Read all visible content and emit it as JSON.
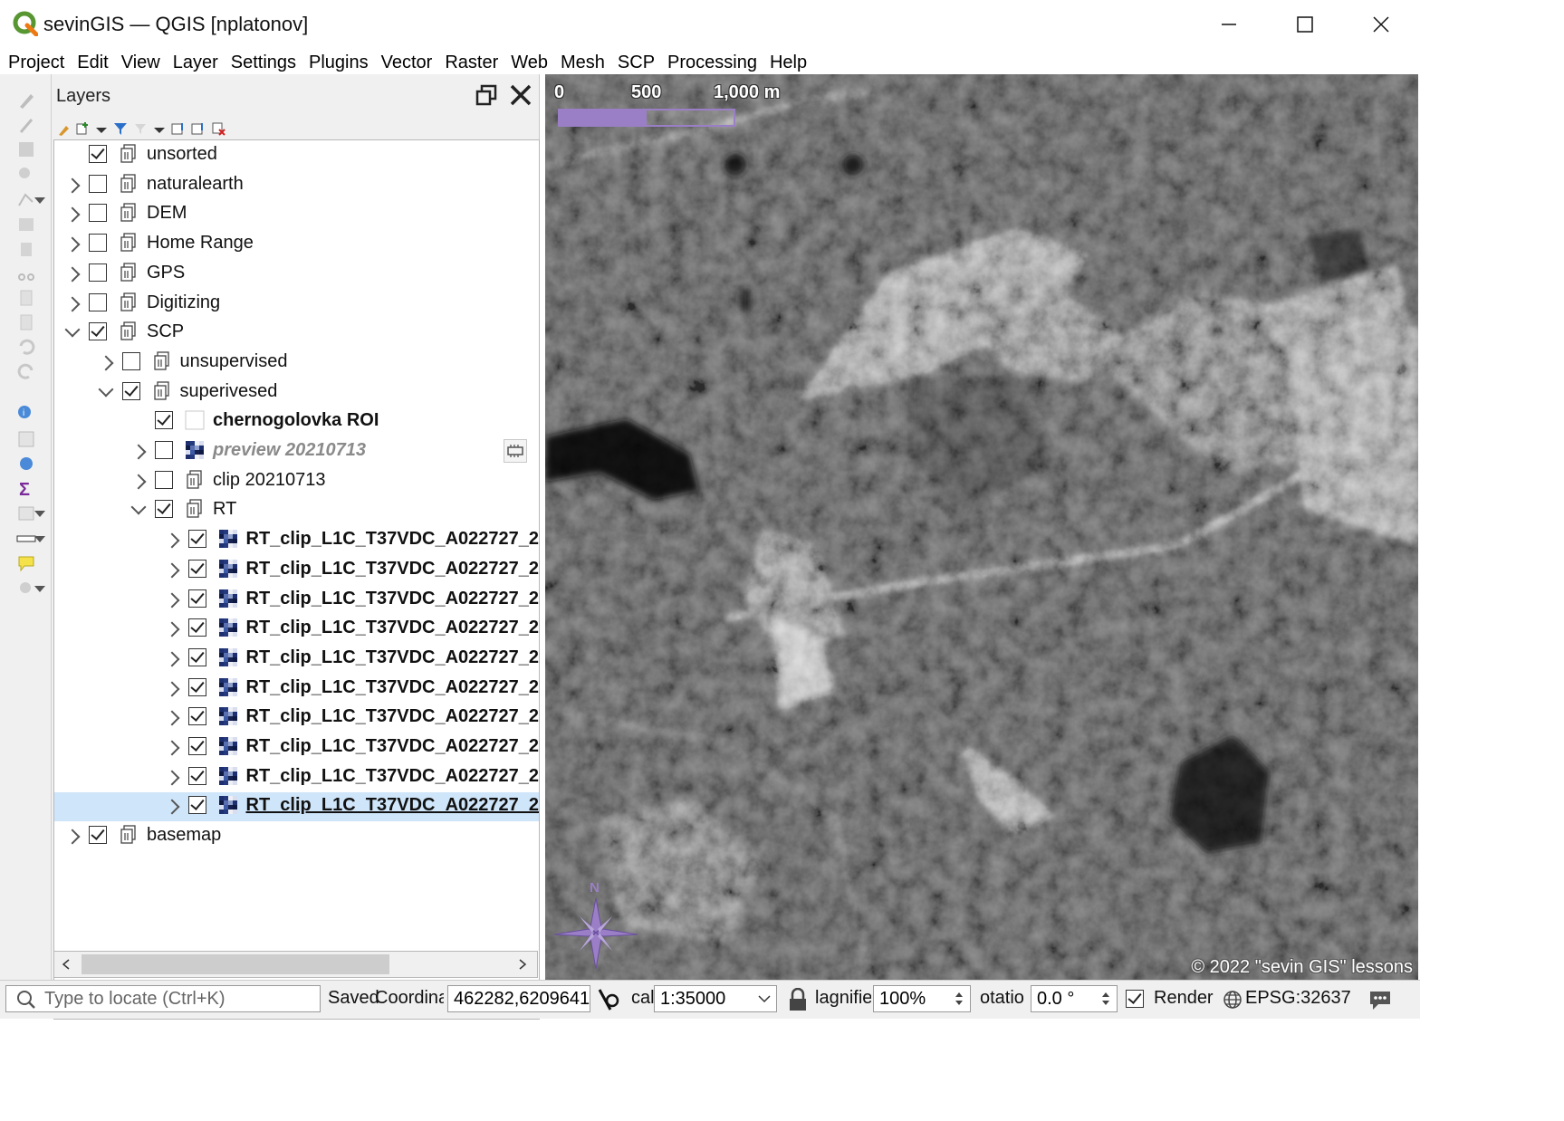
{
  "window": {
    "title": "sevinGIS — QGIS [nplatonov]",
    "controls": [
      "minimize",
      "maximize",
      "close"
    ]
  },
  "menu": [
    "Project",
    "Edit",
    "View",
    "Layer",
    "Settings",
    "Plugins",
    "Vector",
    "Raster",
    "Web",
    "Mesh",
    "SCP",
    "Processing",
    "Help"
  ],
  "layers_panel": {
    "title": "Layers",
    "tree": [
      {
        "label": "unsorted",
        "checked": true,
        "expander": "none",
        "icon": "group-icon",
        "level": 0
      },
      {
        "label": "naturalearth",
        "checked": false,
        "expander": "closed",
        "icon": "group-icon",
        "level": 0
      },
      {
        "label": "DEM",
        "checked": false,
        "expander": "closed",
        "icon": "group-icon",
        "level": 0
      },
      {
        "label": "Home Range",
        "checked": false,
        "expander": "closed",
        "icon": "group-icon",
        "level": 0
      },
      {
        "label": "GPS",
        "checked": false,
        "expander": "closed",
        "icon": "group-icon",
        "level": 0
      },
      {
        "label": "Digitizing",
        "checked": false,
        "expander": "closed",
        "icon": "group-icon",
        "level": 0
      },
      {
        "label": "SCP",
        "checked": true,
        "expander": "open",
        "icon": "group-icon",
        "level": 0
      },
      {
        "label": "unsupervised",
        "checked": false,
        "expander": "closed",
        "icon": "group-icon",
        "level": 1
      },
      {
        "label": "superivesed",
        "checked": true,
        "expander": "open",
        "icon": "group-icon",
        "level": 1
      },
      {
        "label": "chernogolovka ROI",
        "checked": true,
        "expander": "none",
        "icon": "polygon-layer-icon",
        "level": 2,
        "style": "bold"
      },
      {
        "label": "preview 20210713",
        "checked": false,
        "expander": "closed",
        "icon": "raster-layer-icon",
        "level": 2,
        "style": "italic",
        "indicator": "memory-indicator-icon"
      },
      {
        "label": "clip 20210713",
        "checked": false,
        "expander": "closed",
        "icon": "group-icon",
        "level": 2
      },
      {
        "label": "RT",
        "checked": true,
        "expander": "open",
        "icon": "group-icon",
        "level": 2
      },
      {
        "label": "RT_clip_L1C_T37VDC_A022727_2",
        "checked": true,
        "expander": "closed",
        "icon": "raster-layer-icon",
        "level": 3,
        "style": "bold"
      },
      {
        "label": "RT_clip_L1C_T37VDC_A022727_2",
        "checked": true,
        "expander": "closed",
        "icon": "raster-layer-icon",
        "level": 3,
        "style": "bold"
      },
      {
        "label": "RT_clip_L1C_T37VDC_A022727_2",
        "checked": true,
        "expander": "closed",
        "icon": "raster-layer-icon",
        "level": 3,
        "style": "bold"
      },
      {
        "label": "RT_clip_L1C_T37VDC_A022727_2",
        "checked": true,
        "expander": "closed",
        "icon": "raster-layer-icon",
        "level": 3,
        "style": "bold"
      },
      {
        "label": "RT_clip_L1C_T37VDC_A022727_2",
        "checked": true,
        "expander": "closed",
        "icon": "raster-layer-icon",
        "level": 3,
        "style": "bold"
      },
      {
        "label": "RT_clip_L1C_T37VDC_A022727_2",
        "checked": true,
        "expander": "closed",
        "icon": "raster-layer-icon",
        "level": 3,
        "style": "bold"
      },
      {
        "label": "RT_clip_L1C_T37VDC_A022727_2",
        "checked": true,
        "expander": "closed",
        "icon": "raster-layer-icon",
        "level": 3,
        "style": "bold"
      },
      {
        "label": "RT_clip_L1C_T37VDC_A022727_2",
        "checked": true,
        "expander": "closed",
        "icon": "raster-layer-icon",
        "level": 3,
        "style": "bold"
      },
      {
        "label": "RT_clip_L1C_T37VDC_A022727_2",
        "checked": true,
        "expander": "closed",
        "icon": "raster-layer-icon",
        "level": 3,
        "style": "bold"
      },
      {
        "label": "RT_clip_L1C_T37VDC_A022727_2",
        "checked": true,
        "expander": "closed",
        "icon": "raster-layer-icon",
        "level": 3,
        "style": "bold-underline",
        "selected": true
      },
      {
        "label": "basemap",
        "checked": true,
        "expander": "closed",
        "icon": "group-icon",
        "level": 0
      }
    ]
  },
  "map": {
    "scalebar": {
      "labels": [
        "0",
        "500",
        "1,000 m"
      ],
      "color": "#9b7fc6"
    },
    "north_arrow": {
      "label": "N",
      "color": "#9b7fc6"
    },
    "copyright": "© 2022 \"sevin GIS\" lessons"
  },
  "statusbar": {
    "locate_placeholder": "Type to locate (Ctrl+K)",
    "message": "Saved",
    "coordinate_label": "Coordinat",
    "coordinate_value": "462282,6209641",
    "scale_label": "cal",
    "scale_value": "1:35000",
    "magnifier_label": "lagnifie",
    "magnifier_value": "100%",
    "rotation_label": "otatio",
    "rotation_value": "0.0 °",
    "render_label": "Render",
    "render_checked": true,
    "crs": "EPSG:32637"
  }
}
